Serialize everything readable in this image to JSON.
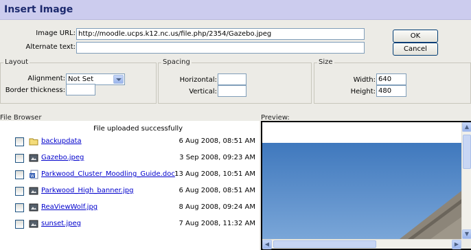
{
  "dialog": {
    "title": "Insert Image"
  },
  "form": {
    "image_url_label": "Image URL:",
    "image_url_value": "http://moodle.ucps.k12.nc.us/file.php/2354/Gazebo.jpeg",
    "alt_text_label": "Alternate text:",
    "alt_text_value": "",
    "ok_label": "OK",
    "cancel_label": "Cancel"
  },
  "layout": {
    "legend": "Layout",
    "alignment_label": "Alignment:",
    "alignment_value": "Not Set",
    "border_label": "Border thickness:",
    "border_value": ""
  },
  "spacing": {
    "legend": "Spacing",
    "horizontal_label": "Horizontal:",
    "horizontal_value": "",
    "vertical_label": "Vertical:",
    "vertical_value": ""
  },
  "size": {
    "legend": "Size",
    "width_label": "Width:",
    "width_value": "640",
    "height_label": "Height:",
    "height_value": "480"
  },
  "file_browser": {
    "label": "File Browser",
    "status": "File uploaded successfully",
    "files": [
      {
        "name": "backupdata",
        "date": "6 Aug 2008, 08:51 AM",
        "icon": "folder-icon"
      },
      {
        "name": "Gazebo.jpeg",
        "date": "3 Sep 2008, 09:23 AM",
        "icon": "image-file-icon"
      },
      {
        "name": "Parkwood_Cluster_Moodling_Guide.doc",
        "date": "13 Aug 2008, 10:51 AM",
        "icon": "word-doc-icon"
      },
      {
        "name": "Parkwood_High_banner.jpg",
        "date": "6 Aug 2008, 08:51 AM",
        "icon": "image-file-icon"
      },
      {
        "name": "ReaViewWolf.jpg",
        "date": "8 Aug 2008, 09:24 AM",
        "icon": "image-file-icon"
      },
      {
        "name": "sunset.jpeg",
        "date": "7 Aug 2008, 11:32 AM",
        "icon": "image-file-icon"
      }
    ]
  },
  "preview": {
    "label": "Preview:"
  },
  "colors": {
    "title_bar": "#ccccee",
    "title_text": "#1d2a6e",
    "link": "#0000cc",
    "sky": "#4f86c6"
  }
}
